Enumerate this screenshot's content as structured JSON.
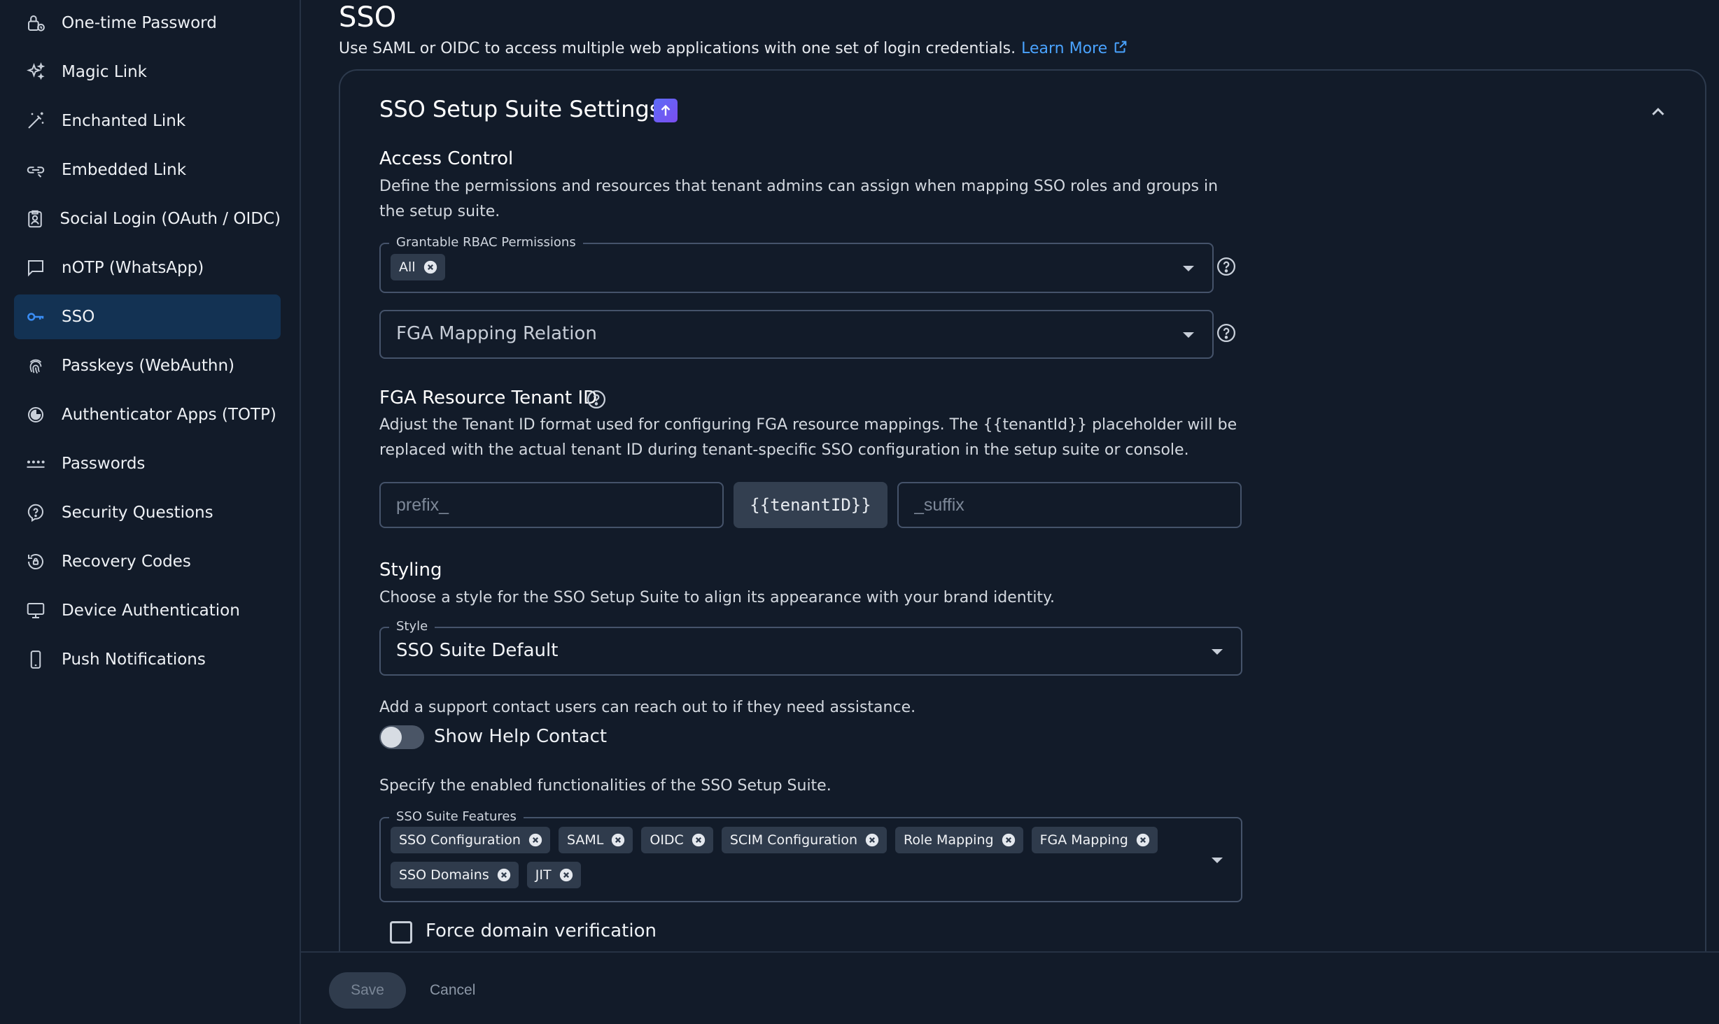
{
  "sidebar": {
    "items": [
      {
        "label": "One-time Password",
        "icon": "lock-refresh-icon"
      },
      {
        "label": "Magic Link",
        "icon": "sparkles-icon"
      },
      {
        "label": "Enchanted Link",
        "icon": "magic-wand-icon"
      },
      {
        "label": "Embedded Link",
        "icon": "link-icon"
      },
      {
        "label": "Social Login (OAuth / OIDC)",
        "icon": "id-badge-icon"
      },
      {
        "label": "nOTP (WhatsApp)",
        "icon": "chat-icon"
      },
      {
        "label": "SSO",
        "icon": "key-icon",
        "active": true
      },
      {
        "label": "Passkeys (WebAuthn)",
        "icon": "fingerprint-icon"
      },
      {
        "label": "Authenticator Apps (TOTP)",
        "icon": "authenticator-icon"
      },
      {
        "label": "Passwords",
        "icon": "password-dots-icon"
      },
      {
        "label": "Security Questions",
        "icon": "question-shield-icon"
      },
      {
        "label": "Recovery Codes",
        "icon": "recovery-icon"
      },
      {
        "label": "Device Authentication",
        "icon": "monitor-icon"
      },
      {
        "label": "Push Notifications",
        "icon": "phone-icon"
      }
    ]
  },
  "header": {
    "title": "SSO",
    "description": "Use SAML or OIDC to access multiple web applications with one set of login credentials.",
    "learn_more": "Learn More"
  },
  "card": {
    "title": "SSO Setup Suite Settings",
    "access_control": {
      "title": "Access Control",
      "description": "Define the permissions and resources that tenant admins can assign when mapping SSO roles and groups in the setup suite.",
      "rbac_label": "Grantable RBAC Permissions",
      "rbac_chips": [
        "All"
      ],
      "fga_mapping_placeholder": "FGA Mapping Relation"
    },
    "fga_tenant": {
      "title": "FGA Resource Tenant ID",
      "description": "Adjust the Tenant ID format used for configuring FGA resource mappings. The {{tenantId}} placeholder will be replaced with the actual tenant ID during tenant-specific SSO configuration in the setup suite or console.",
      "prefix_placeholder": "prefix_",
      "tenant_token": "{{tenantID}}",
      "suffix_placeholder": "_suffix"
    },
    "styling": {
      "title": "Styling",
      "description": "Choose a style for the SSO Setup Suite to align its appearance with your brand identity.",
      "style_label": "Style",
      "style_value": "SSO Suite Default"
    },
    "help_contact": {
      "description": "Add a support contact users can reach out to if they need assistance.",
      "toggle_label": "Show Help Contact",
      "enabled": false
    },
    "features": {
      "description": "Specify the enabled functionalities of the SSO Setup Suite.",
      "label": "SSO Suite Features",
      "chips_row1": [
        "SSO Configuration",
        "SAML",
        "OIDC",
        "SCIM Configuration",
        "Role Mapping",
        "FGA Mapping"
      ],
      "chips_row2": [
        "SSO Domains",
        "JIT"
      ]
    },
    "force_domain": {
      "label": "Force domain verification",
      "checked": false
    }
  },
  "footer": {
    "save": "Save",
    "cancel": "Cancel"
  },
  "colors": {
    "background": "#121b29",
    "active_nav": "#133253",
    "accent_link": "#4aa3ff",
    "key_icon": "#3a8ef6"
  }
}
